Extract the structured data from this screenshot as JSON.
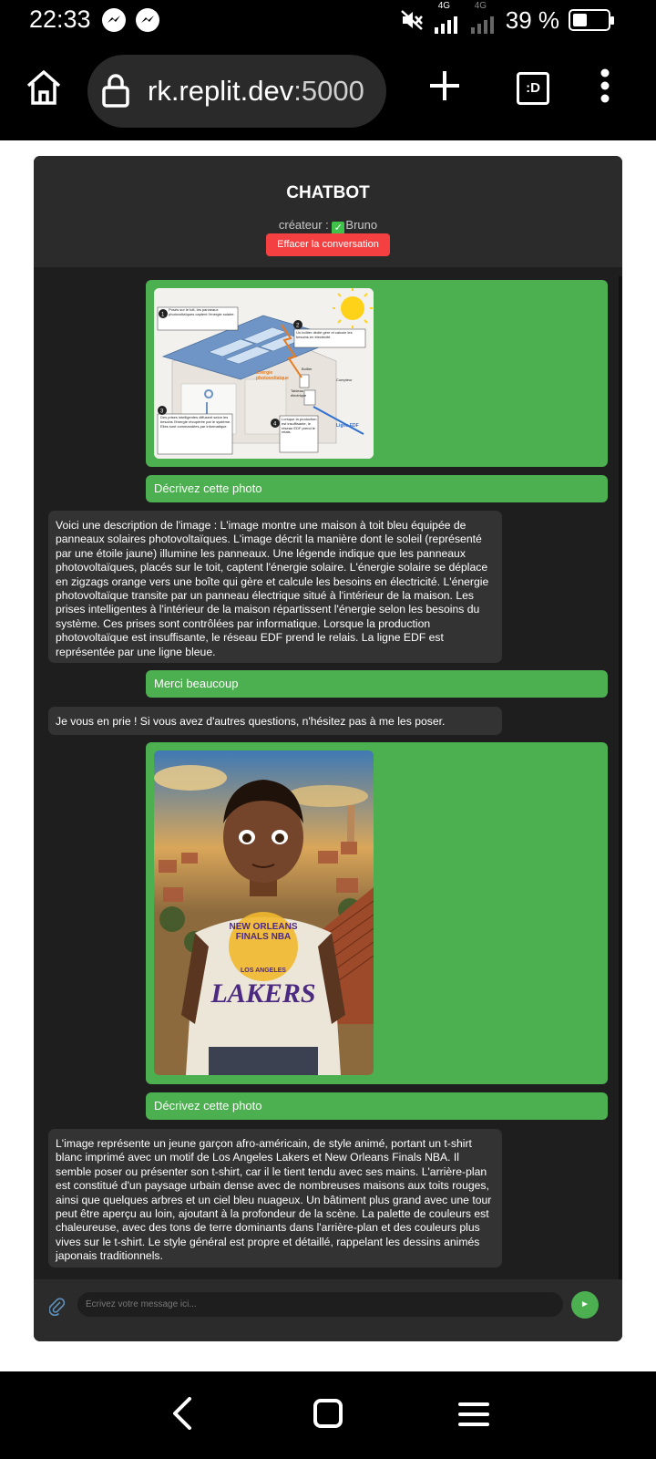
{
  "status_bar": {
    "time": "22:33",
    "network1": "4G",
    "network2": "4G",
    "battery": "39 %",
    "battery_level": 0.39
  },
  "browser": {
    "url_host": "rk.replit.dev",
    "url_port": ":5000",
    "tabs_label": ":D"
  },
  "chat": {
    "title": "CHATBOT",
    "creator_prefix": "créateur : ",
    "creator_name": "Bruno",
    "clear_button": "Effacer la conversation",
    "messages": [
      {
        "role": "user",
        "image": "solar-house-diagram",
        "image_labels": {
          "c1": "Posés sur le toit, les panneaux photovoltaïques captent l'énergie solaire.",
          "c2": "Un boîtier dédié gère et calcule les besoins en électricité.",
          "c3": "Des prises intelligentes diffusent selon les besoins l'énergie récupérée par le système. Elles sont commandées par informatique.",
          "c4": "Lorsque la production est insuffisante, le réseau EDF prend le relais.",
          "energy": "Énergie photovoltaïque",
          "boitier": "Boîtier",
          "compteur": "Compteur",
          "tableau": "Tableau électrique",
          "ligne": "Ligne EDF"
        }
      },
      {
        "role": "user",
        "text": "Décrivez cette photo"
      },
      {
        "role": "bot",
        "text": "Voici une description de l'image : L'image montre une maison à toit bleu équipée de panneaux solaires photovoltaïques. L'image décrit la manière dont le soleil (représenté par une étoile jaune) illumine les panneaux. Une légende indique que les panneaux photovoltaïques, placés sur le toit, captent l'énergie solaire. L'énergie solaire se déplace en zigzags orange vers une boîte qui gère et calcule les besoins en électricité. L'énergie photovoltaïque transite par un panneau électrique situé à l'intérieur de la maison. Les prises intelligentes à l'intérieur de la maison répartissent l'énergie selon les besoins du système. Ces prises sont contrôlées par informatique. Lorsque la production photovoltaïque est insuffisante, le réseau EDF prend le relais. La ligne EDF est représentée par une ligne bleue."
      },
      {
        "role": "user",
        "text": "Merci beaucoup"
      },
      {
        "role": "bot",
        "text": "Je vous en prie ! Si vous avez d'autres questions, n'hésitez pas à me les poser."
      },
      {
        "role": "user",
        "image": "boy-lakers-illustration",
        "image_labels": {
          "shirt_top": "NEW ORLEANS FINALS NBA",
          "shirt_small": "LOS ANGELES",
          "shirt_main": "LAKERS"
        }
      },
      {
        "role": "user",
        "text": "Décrivez cette photo"
      },
      {
        "role": "bot",
        "text": "L'image représente un jeune garçon afro-américain, de style animé, portant un t-shirt blanc imprimé avec un motif de Los Angeles Lakers et New Orleans Finals NBA. Il semble poser ou présenter son t-shirt, car il le tient tendu avec ses mains. L'arrière-plan est constitué d'un paysage urbain dense avec de nombreuses maisons aux toits rouges, ainsi que quelques arbres et un ciel bleu nuageux. Un bâtiment plus grand avec une tour peut être aperçu au loin, ajoutant à la profondeur de la scène. La palette de couleurs est chaleureuse, avec des tons de terre dominants dans l'arrière-plan et des couleurs plus vives sur le t-shirt. Le style général est propre et détaillé, rappelant les dessins animés japonais traditionnels."
      }
    ],
    "input_placeholder": "Écrivez votre message ici...",
    "send_label": "►"
  },
  "colors": {
    "accent_green": "#4caf50",
    "danger_red": "#f44040",
    "chat_bg": "#1e1e1e",
    "bot_bubble": "#333333"
  }
}
